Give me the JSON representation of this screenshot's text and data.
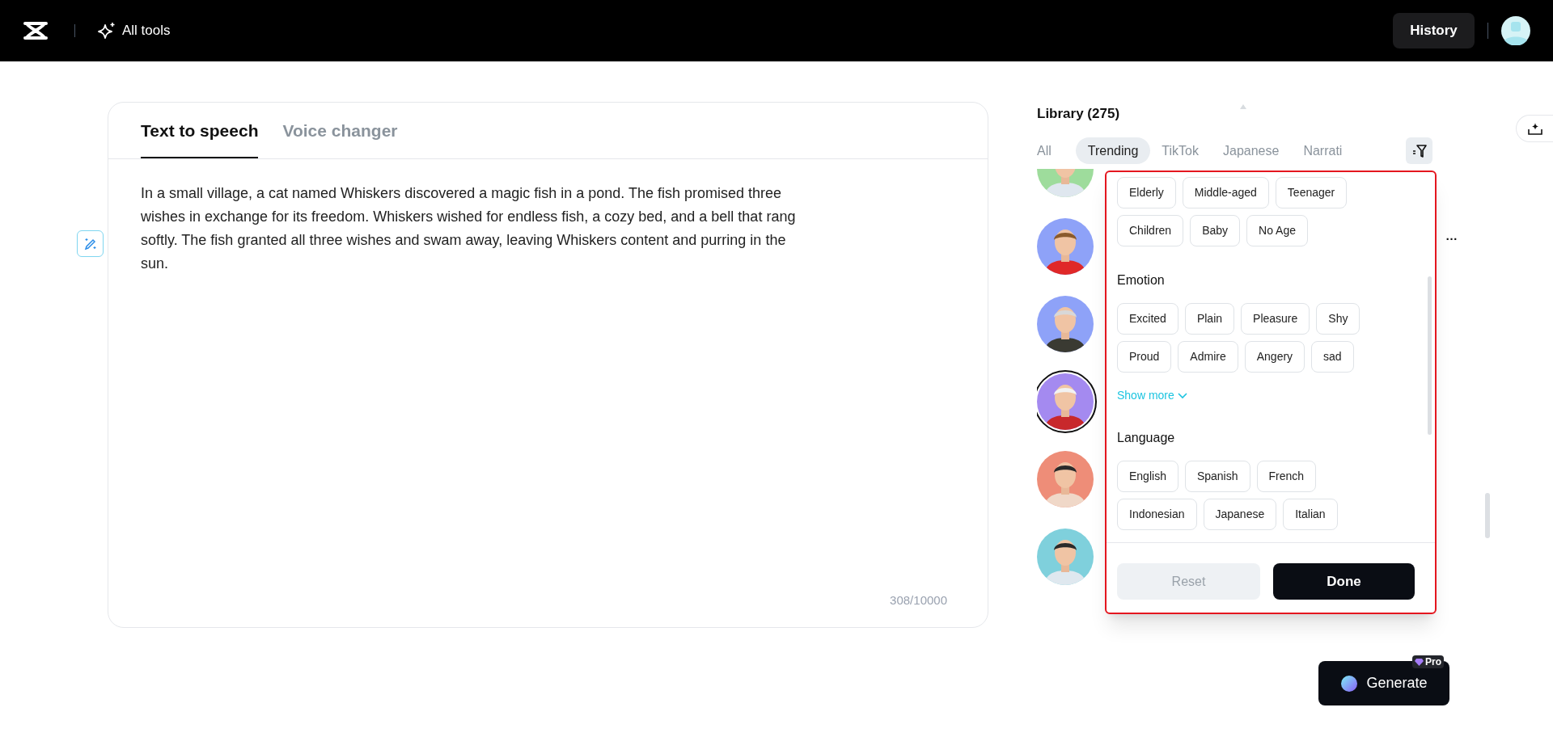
{
  "topbar": {
    "all_tools": "All tools",
    "history": "History"
  },
  "editor": {
    "tabs": [
      {
        "label": "Text to speech",
        "selected": true
      },
      {
        "label": "Voice changer",
        "selected": false
      }
    ],
    "text": "In a small village, a cat named Whiskers discovered a magic fish in a pond. The fish promised three wishes in exchange for its freedom. Whiskers wished for endless fish, a cozy bed, and a bell that rang softly. The fish granted all three wishes and swam away, leaving Whiskers content and purring in the sun.",
    "counter": "308/10000"
  },
  "library": {
    "title": "Library (275)",
    "tabs": [
      {
        "label": "All",
        "selected": false
      },
      {
        "label": "Trending",
        "selected": true
      },
      {
        "label": "TikTok",
        "selected": false
      },
      {
        "label": "Japanese",
        "selected": false
      },
      {
        "label": "Narrati",
        "selected": false
      }
    ],
    "voices": [
      {
        "selected": false
      },
      {
        "selected": false,
        "name": "…"
      },
      {
        "selected": false
      },
      {
        "selected": true
      },
      {
        "selected": false
      },
      {
        "selected": false
      }
    ]
  },
  "filter": {
    "sections": [
      {
        "chips": [
          {
            "label": "Elderly",
            "selected": false
          },
          {
            "label": "Middle-aged",
            "selected": false
          },
          {
            "label": "Teenager",
            "selected": false
          },
          {
            "label": "Children",
            "selected": false
          },
          {
            "label": "Baby",
            "selected": false
          },
          {
            "label": "No Age",
            "selected": false
          }
        ]
      },
      {
        "title": "Emotion",
        "chips": [
          {
            "label": "Excited",
            "selected": false
          },
          {
            "label": "Plain",
            "selected": false
          },
          {
            "label": "Pleasure",
            "selected": false
          },
          {
            "label": "Shy",
            "selected": false
          },
          {
            "label": "Proud",
            "selected": false
          },
          {
            "label": "Admire",
            "selected": false
          },
          {
            "label": "Angery",
            "selected": false
          },
          {
            "label": "sad",
            "selected": false
          }
        ],
        "show_more": "Show more"
      },
      {
        "title": "Language",
        "chips": [
          {
            "label": "English",
            "selected": false
          },
          {
            "label": "Spanish",
            "selected": false
          },
          {
            "label": "French",
            "selected": false
          },
          {
            "label": "Indonesian",
            "selected": false
          },
          {
            "label": "Japanese",
            "selected": false
          },
          {
            "label": "Italian",
            "selected": false
          }
        ]
      }
    ],
    "reset": {
      "label": "Reset",
      "disabled": true
    },
    "done": {
      "label": "Done"
    }
  },
  "generate": {
    "label": "Generate",
    "badge": "Pro"
  }
}
